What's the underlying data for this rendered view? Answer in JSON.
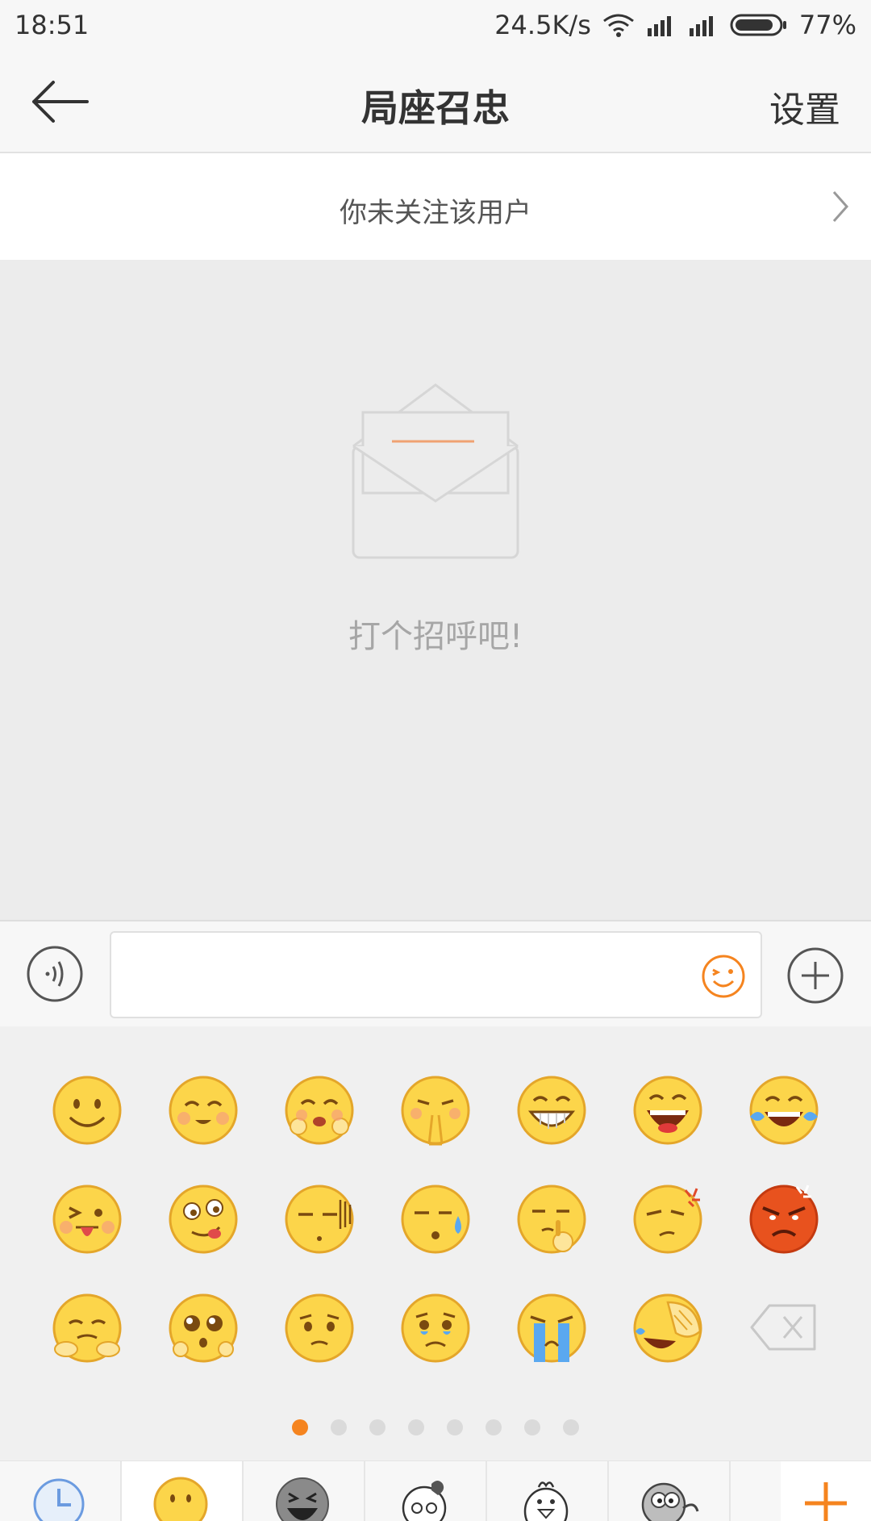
{
  "status": {
    "time": "18:51",
    "speed": "24.5K/s",
    "battery": "77%"
  },
  "header": {
    "title": "局座召忠",
    "settings_label": "设置"
  },
  "follow_banner": {
    "text": "你未关注该用户"
  },
  "empty_state": {
    "text": "打个招呼吧!"
  },
  "input": {
    "placeholder": ""
  },
  "emoji_panel": {
    "rows": [
      [
        "smile",
        "blush-smile",
        "hug-happy",
        "pray",
        "grin",
        "laugh",
        "tears-of-joy"
      ],
      [
        "tongue-wink",
        "drool",
        "speechless",
        "sweat",
        "pick-nose",
        "annoyed",
        "angry"
      ],
      [
        "shy-hands",
        "pitiful",
        "sad",
        "teary",
        "crying",
        "facepalm-laugh",
        "delete-key"
      ]
    ],
    "pages": 8,
    "active_page": 1
  },
  "tabs": [
    {
      "icon": "recent-clock-icon",
      "active": false
    },
    {
      "icon": "default-smiley-icon",
      "active": true
    },
    {
      "icon": "grey-laugh-sticker-icon",
      "active": false
    },
    {
      "icon": "cartoon-sticker-icon",
      "active": false
    },
    {
      "icon": "chicken-sticker-icon",
      "active": false
    },
    {
      "icon": "bird-sticker-icon",
      "active": false
    }
  ],
  "colors": {
    "accent": "#f5841f",
    "chat_bg": "#ececec",
    "bar_bg": "#f7f7f7"
  }
}
